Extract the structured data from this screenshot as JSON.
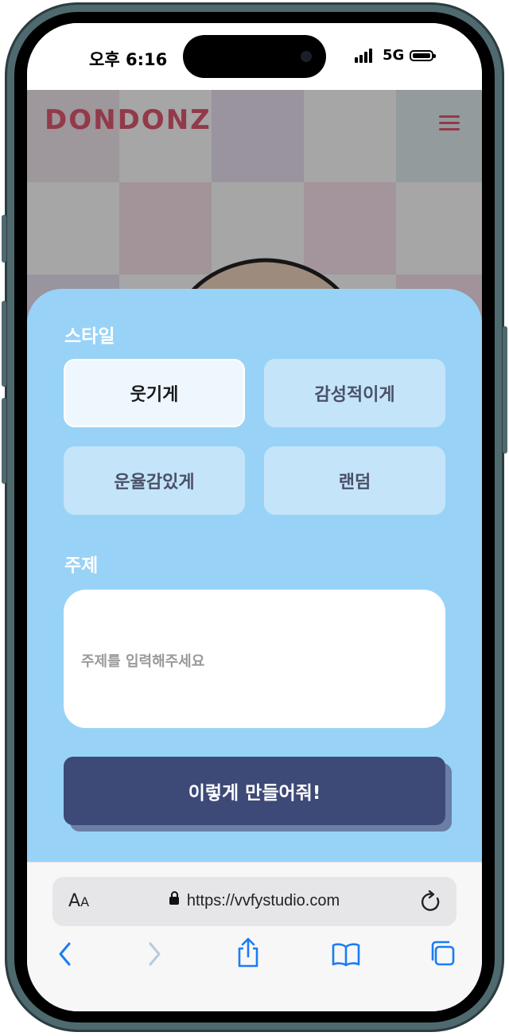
{
  "status_bar": {
    "time": "오후 6:16",
    "network": "5G"
  },
  "site": {
    "logo_text": "DONDONZ"
  },
  "form": {
    "style_label": "스타일",
    "style_options": [
      {
        "label": "웃기게",
        "selected": true
      },
      {
        "label": "감성적이게",
        "selected": false
      },
      {
        "label": "운율감있게",
        "selected": false
      },
      {
        "label": "랜덤",
        "selected": false
      }
    ],
    "topic_label": "주제",
    "topic_placeholder": "주제를 입력해주세요",
    "submit_label": "이렇게 만들어줘!"
  },
  "browser": {
    "text_size_label_big": "A",
    "text_size_label_small": "A",
    "url": "https://vvfystudio.com"
  },
  "colors": {
    "sheet_bg": "#99d2f7",
    "option_bg": "#c4e4fa",
    "selected_bg": "#eef7fe",
    "submit_bg": "#3d4977",
    "ios_blue": "#1a7cf5",
    "logo": "#e05a70"
  },
  "icons": [
    "menu-icon",
    "lock-icon",
    "reload-icon",
    "back-icon",
    "forward-icon",
    "share-icon",
    "bookmarks-icon",
    "tabs-icon"
  ]
}
